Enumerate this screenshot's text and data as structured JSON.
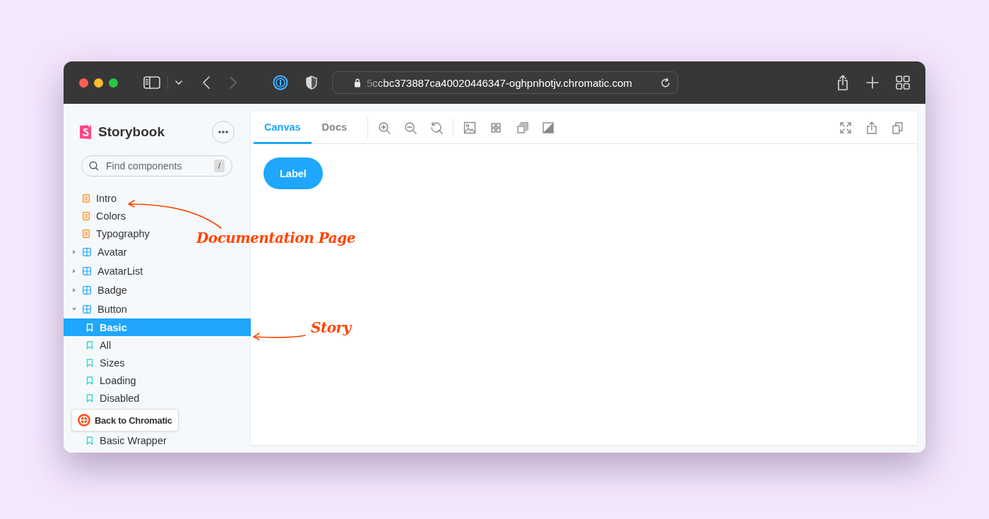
{
  "browser": {
    "address": "5ccbc373887ca40020446347-oghpnhotjv.chromatic.com",
    "back_enabled": true,
    "forward_enabled": false
  },
  "sidebar": {
    "brand": "Storybook",
    "search": {
      "placeholder": "Find components",
      "shortcut": "/"
    },
    "tree": [
      {
        "kind": "doc",
        "label": "Intro",
        "selected": false
      },
      {
        "kind": "doc",
        "label": "Colors",
        "selected": false
      },
      {
        "kind": "doc",
        "label": "Typography",
        "selected": false
      },
      {
        "kind": "component",
        "label": "Avatar",
        "expanded": false,
        "selected": false
      },
      {
        "kind": "component",
        "label": "AvatarList",
        "expanded": false,
        "selected": false
      },
      {
        "kind": "component",
        "label": "Badge",
        "expanded": false,
        "selected": false
      },
      {
        "kind": "component",
        "label": "Button",
        "expanded": true,
        "selected": false,
        "children": [
          {
            "kind": "story",
            "label": "Basic",
            "selected": true
          },
          {
            "kind": "story",
            "label": "All",
            "selected": false
          },
          {
            "kind": "story",
            "label": "Sizes",
            "selected": false
          },
          {
            "kind": "story",
            "label": "Loading",
            "selected": false
          },
          {
            "kind": "story",
            "label": "Disabled",
            "selected": false
          },
          {
            "kind": "story",
            "label": "Basic Wrapper",
            "selected": false
          }
        ]
      }
    ],
    "back_button": "Back to Chromatic"
  },
  "preview": {
    "tabs": [
      {
        "label": "Canvas",
        "selected": true
      },
      {
        "label": "Docs",
        "selected": false
      }
    ],
    "story_button": "Label"
  },
  "annotations": [
    {
      "text": "Documentation Page"
    },
    {
      "text": "Story"
    }
  ]
}
